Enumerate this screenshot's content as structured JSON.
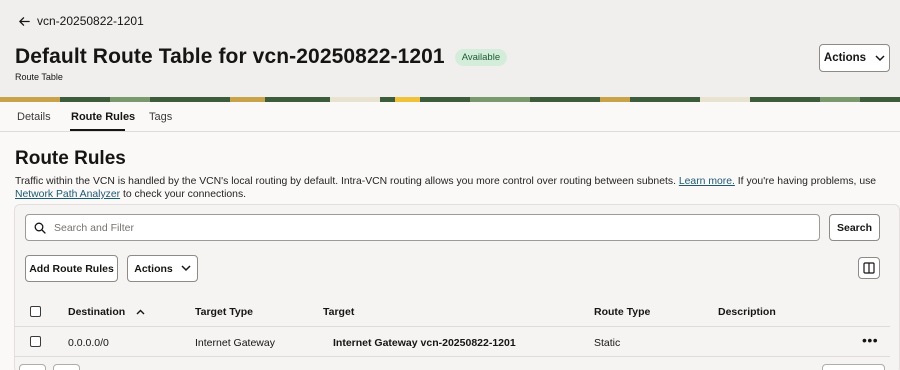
{
  "header": {
    "back_label": "vcn-20250822-1201",
    "title": "Default Route Table for vcn-20250822-1201",
    "status_badge": "Available",
    "subtitle": "Route Table",
    "actions_label": "Actions"
  },
  "tabs": [
    {
      "label": "Details"
    },
    {
      "label": "Route Rules"
    },
    {
      "label": "Tags"
    }
  ],
  "section": {
    "title": "Route Rules",
    "desc_part1": "Traffic within the VCN is handled by the VCN's local routing by default. Intra-VCN routing allows you more control over routing between subnets.",
    "learn_more": "Learn more.",
    "desc_part2": "If you're having problems, use",
    "network_path_analyzer": "Network Path Analyzer",
    "desc_part3": "to check your connections."
  },
  "toolbar": {
    "search_placeholder": "Search and Filter",
    "search_button": "Search",
    "add_button": "Add Route Rules",
    "actions_button": "Actions"
  },
  "table": {
    "columns": [
      "Destination",
      "Target Type",
      "Target",
      "Route Type",
      "Description"
    ],
    "rows": [
      {
        "destination": "0.0.0.0/0",
        "target_type": "Internet Gateway",
        "target": "Internet Gateway vcn-20250822-1201",
        "route_type": "Static",
        "description": ""
      }
    ]
  },
  "colors": {
    "badge_bg": "#d4eddb",
    "link": "#1c5a73",
    "banner": "#3d5c3b"
  }
}
